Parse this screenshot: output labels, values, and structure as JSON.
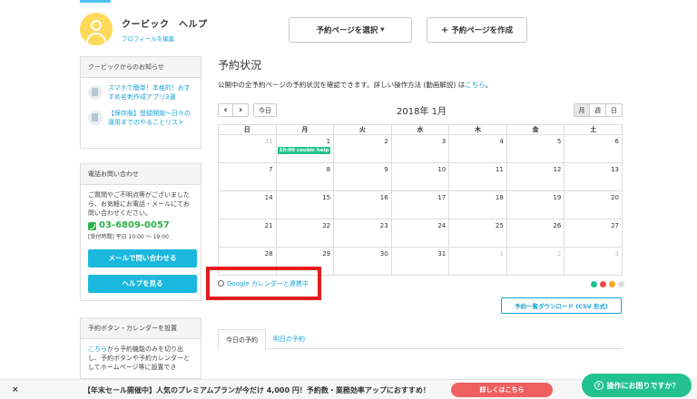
{
  "profile": {
    "name": "クービック　ヘルプ",
    "edit_link": "プロフィールを編集"
  },
  "header": {
    "select_page_label": "予約ページを選択",
    "select_caret": "▾",
    "create_page_label": "予約ページを作成",
    "create_plus": "+"
  },
  "news": {
    "title": "クービックからのお知らせ",
    "items": [
      {
        "text": "スマホで簡単！本格的！おすすめ名刺作成アプリ3選"
      },
      {
        "text": "【保存版】登録開始〜日々の運用までのやることリスト"
      }
    ]
  },
  "contact": {
    "title": "電話お問い合わせ",
    "body": "ご質問やご不明点等がございましたら、お気軽にお電話・メールにてお問い合わせください。",
    "phone": "03-6809-0057",
    "hours": "[受付時間] 平日 10:00 〜 19:00",
    "mail_button": "メールで問い合わせる",
    "help_button": "ヘルプを見る"
  },
  "reserve_button_panel": {
    "title": "予約ボタン・カレンダーを設置",
    "body_link": "こちら",
    "body": "から予約機能のみを切り出し、予約ボタンや予約カレンダーとしてホームページ等に設置でき"
  },
  "main": {
    "title": "予約状況",
    "desc": "公開中の全予約ページの予約状況を確認できます。詳しい操作方法 (動画解説) は",
    "desc_link": "こちら",
    "desc_end": "。"
  },
  "calendar": {
    "prev": "‹",
    "next": "›",
    "today": "今日",
    "month_label": "2018年 1月",
    "views": [
      "月",
      "週",
      "日"
    ],
    "weekdays": [
      "日",
      "月",
      "火",
      "水",
      "木",
      "金",
      "土"
    ],
    "weeks": [
      [
        "31",
        "1",
        "2",
        "3",
        "4",
        "5",
        "6"
      ],
      [
        "7",
        "8",
        "9",
        "10",
        "11",
        "12",
        "13"
      ],
      [
        "14",
        "15",
        "16",
        "17",
        "18",
        "19",
        "20"
      ],
      [
        "21",
        "22",
        "23",
        "24",
        "25",
        "26",
        "27"
      ],
      [
        "28",
        "29",
        "30",
        "31",
        "1",
        "2",
        "3"
      ]
    ],
    "event": "10:00 coubic help"
  },
  "gcal_link": "Google カレンダーと連携中",
  "dot_colors": [
    "#21c28f",
    "#ef4b4b",
    "#f5a623",
    "#dddddd"
  ],
  "csv_button": "予約一覧ダウンロード (CSV 形式)",
  "tabs": [
    "今日の予約",
    "明日の予約"
  ],
  "banner": {
    "close": "×",
    "text": "【年末セール開催中】人気のプレミアムプランが今だけ 4,000 円！予約数・業務効率アップにおすすめ！",
    "button": "詳しくはこちら"
  },
  "help_chat": {
    "icon": "?",
    "label": "操作にお困りですか？"
  }
}
